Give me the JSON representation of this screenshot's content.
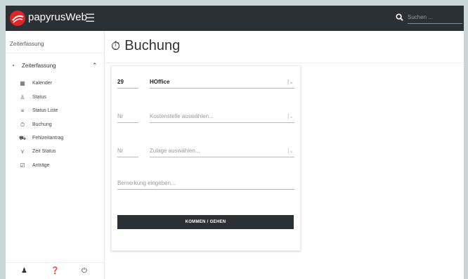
{
  "app": {
    "brand": "papyrusWeb",
    "menu_icon": "☰"
  },
  "search": {
    "placeholder": "Suchen ..."
  },
  "sidebar": {
    "header": "Zeiterfassung",
    "group": {
      "label": "Zeiterfassung",
      "icon": "clock-icon"
    },
    "items": [
      {
        "label": "Kalender",
        "icon": "calendar-icon"
      },
      {
        "label": "Status",
        "icon": "users-icon"
      },
      {
        "label": "Status Liste",
        "icon": "list-icon"
      },
      {
        "label": "Buchung",
        "icon": "stopwatch-icon"
      },
      {
        "label": "Fehlzeitantrag",
        "icon": "car-icon"
      },
      {
        "label": "Zeit Status",
        "icon": "sitemap-icon"
      },
      {
        "label": "Anträge",
        "icon": "calendar-check-icon"
      }
    ],
    "footer_icons": [
      "user-icon",
      "help-icon",
      "power-icon"
    ]
  },
  "page": {
    "title": "Buchung"
  },
  "form": {
    "row1": {
      "nr": "29",
      "select": "HOffice"
    },
    "row2": {
      "nr": "Nr",
      "select": "Kostenstelle auswählen..."
    },
    "row3": {
      "nr": "Nr",
      "select": "Zulage auswählen..."
    },
    "remark_placeholder": "Bemerkung eingeben...",
    "submit_label": "KOMMEN / GEHEN"
  },
  "colors": {
    "topbar": "#2b3035",
    "button": "#2b3035",
    "logo": "#e0262b"
  }
}
